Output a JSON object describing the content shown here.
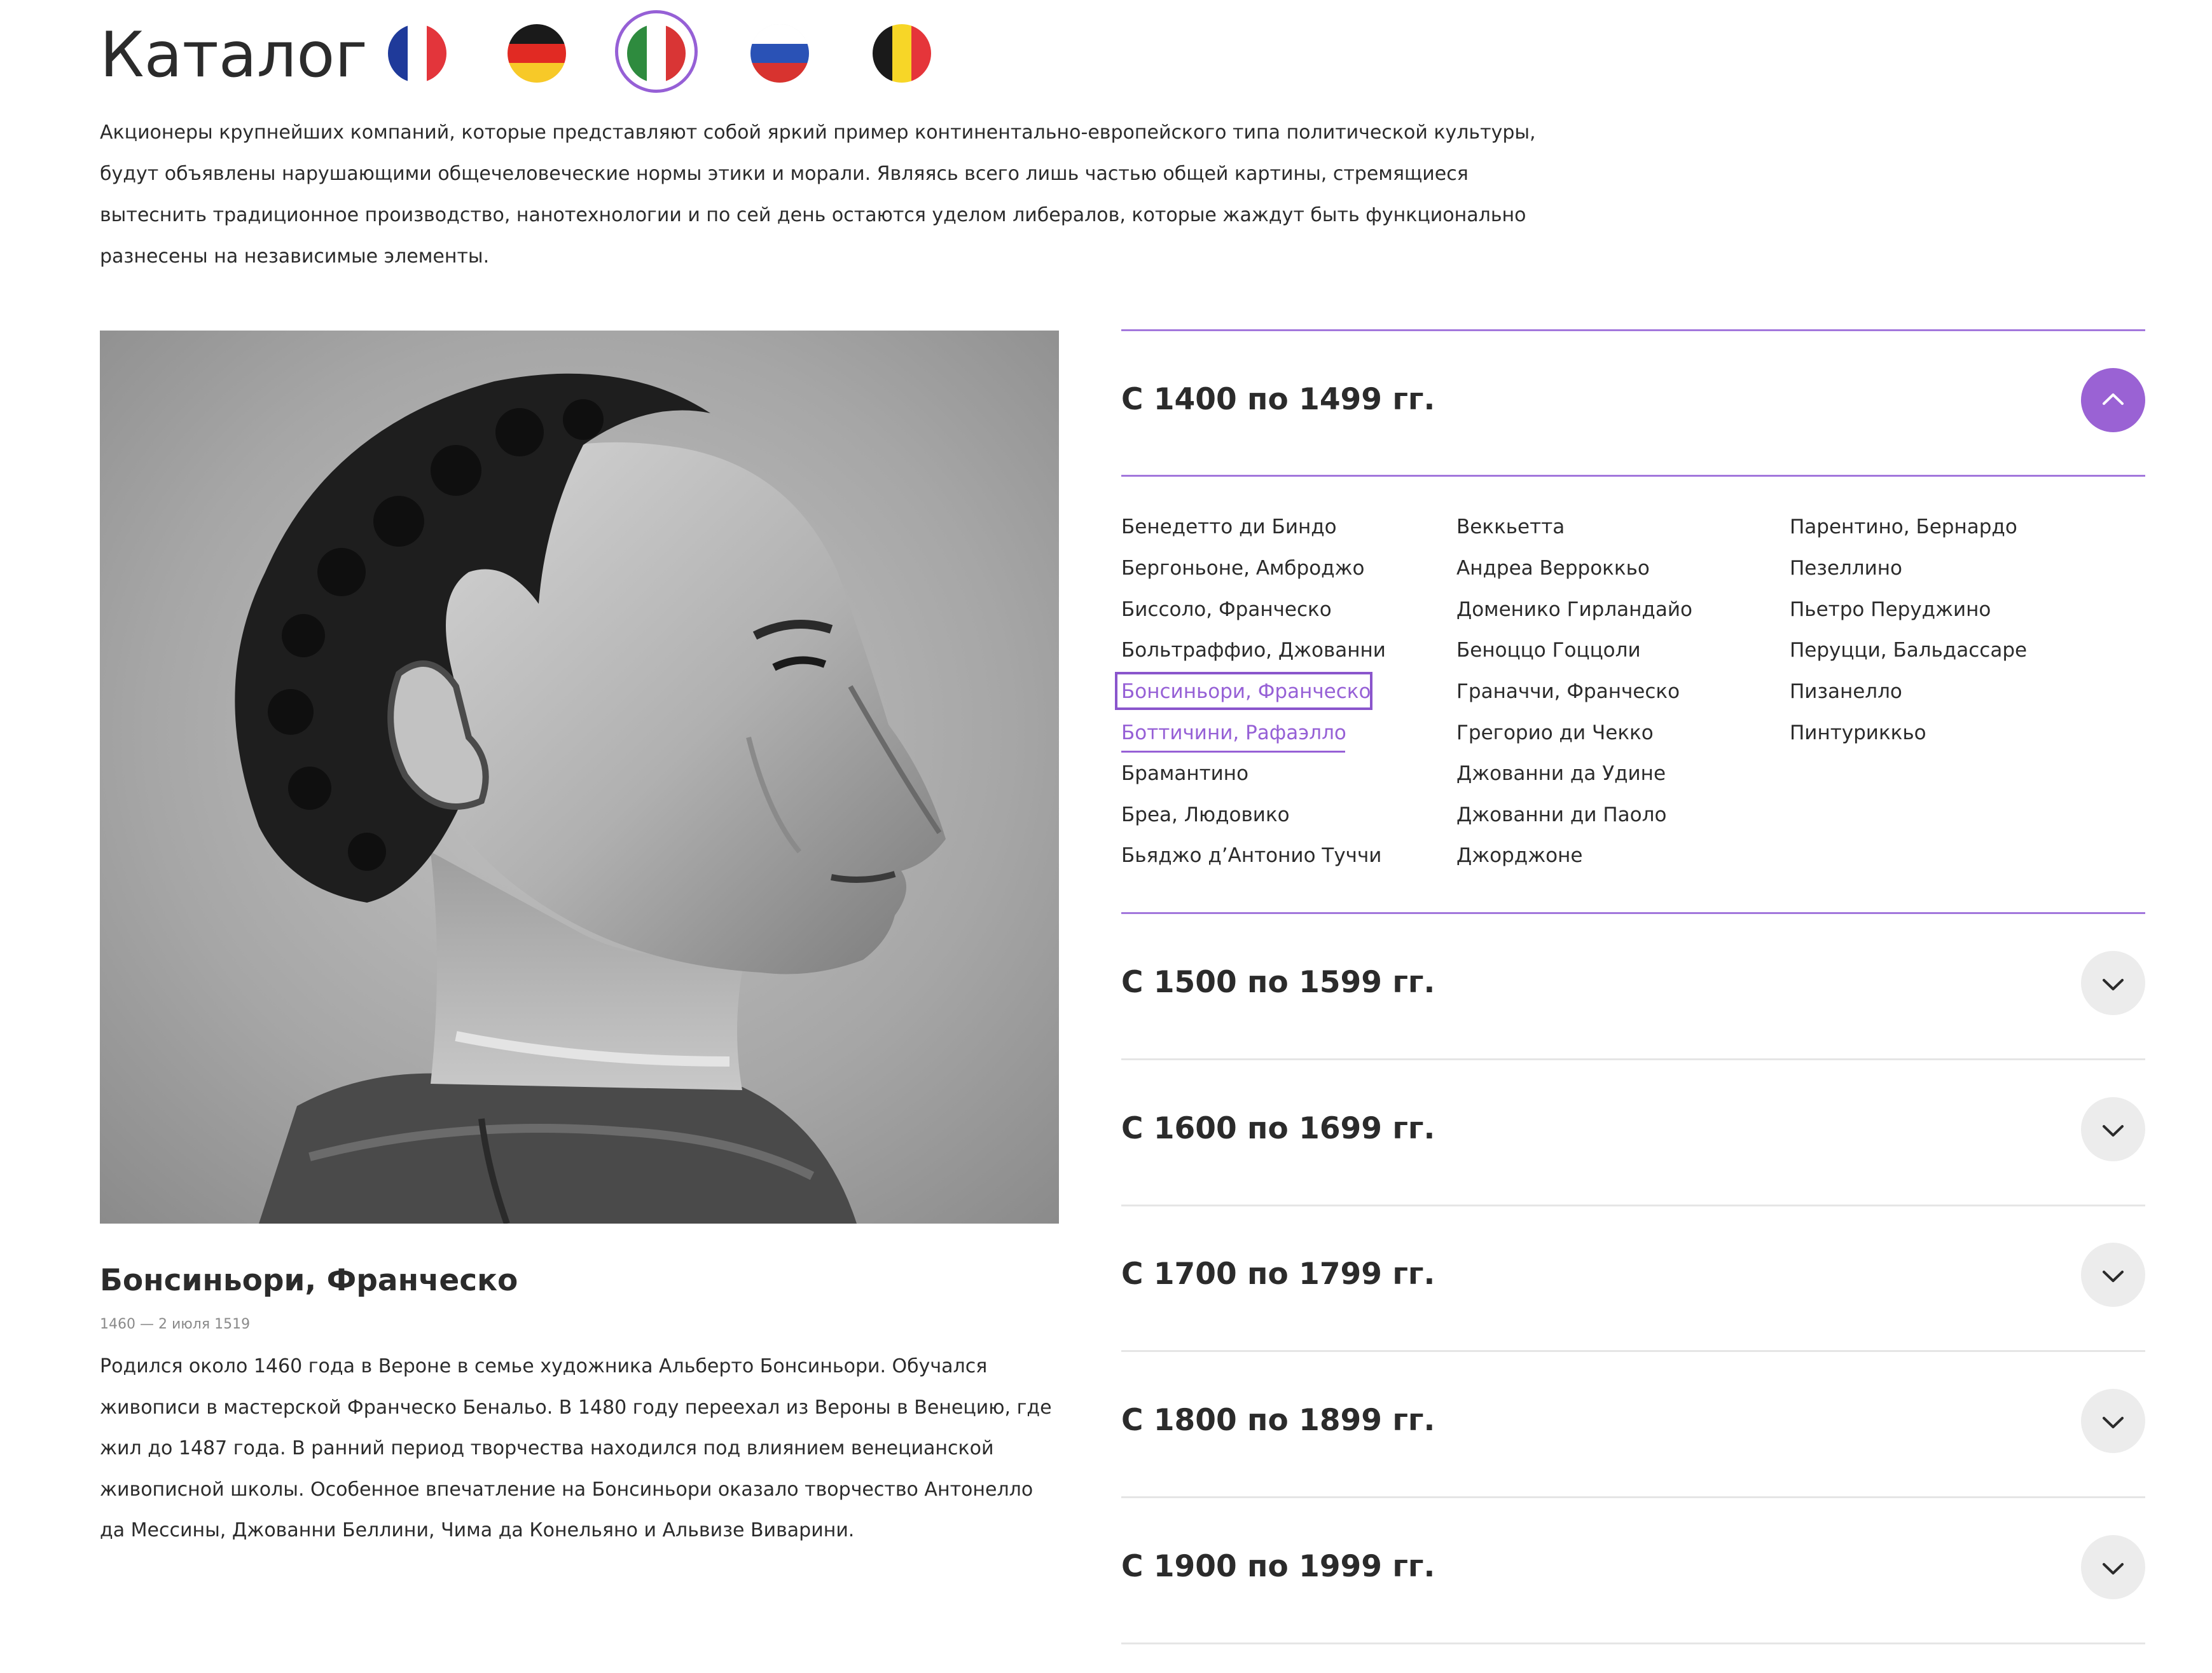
{
  "header": {
    "title": "Каталог",
    "flags": [
      {
        "name": "france-flag",
        "colors": [
          "#1f3a9a",
          "#ffffff",
          "#e3353b"
        ],
        "orientation": "vertical",
        "selected": false
      },
      {
        "name": "germany-flag",
        "colors": [
          "#1a1a1a",
          "#e12a23",
          "#f7c928"
        ],
        "orientation": "horizontal",
        "selected": false
      },
      {
        "name": "italy-flag",
        "colors": [
          "#2e8b3e",
          "#ffffff",
          "#d93535"
        ],
        "orientation": "vertical",
        "selected": true
      },
      {
        "name": "russia-flag",
        "colors": [
          "#ffffff",
          "#2a52b6",
          "#d8332f"
        ],
        "orientation": "horizontal",
        "selected": false
      },
      {
        "name": "belgium-flag",
        "colors": [
          "#1a1a1a",
          "#f7d627",
          "#e5353a"
        ],
        "orientation": "vertical",
        "selected": false
      }
    ]
  },
  "intro": {
    "text": "Акционеры крупнейших компаний, которые представляют собой яркий пример континентально-европейского типа политической культуры, будут объявлены нарушающими общечеловеческие нормы этики и морали. Являясь всего лишь частью общей картины, стремящиеся вытеснить традиционное производство, нанотехнологии и по сей день остаются уделом либералов, которые жаждут быть функционально разнесены на независимые элементы."
  },
  "artist": {
    "name": "Бонсиньори, Франческо",
    "dates": "1460 — 2 июля 1519",
    "bio": "Родился около 1460 года в Вероне в семье художника Альберто Бонсиньори. Обучался живописи в мастерской Франческо Бенальо. В 1480 году переехал из Вероны в Венецию, где жил до 1487 года. В ранний период творчества находился под влиянием венецианской живописной школы. Особенное впечатление на Бонсиньори оказало творчество Антонелло да Мессины, Джованни Беллини, Чима да Конельяно и Альвизе Виварини."
  },
  "periods": [
    {
      "title": "С 1400 по 1499 гг.",
      "open": true
    },
    {
      "title": "С 1500 по 1599 гг.",
      "open": false
    },
    {
      "title": "С 1600 по 1699 гг.",
      "open": false
    },
    {
      "title": "С 1700 по 1799 гг.",
      "open": false
    },
    {
      "title": "С 1800 по 1899 гг.",
      "open": false
    },
    {
      "title": "С 1900 по 1999 гг.",
      "open": false
    }
  ],
  "artist_columns": [
    [
      "Бенедетто ди Биндо",
      "Бергоньоне, Амброджо",
      "Биссоло, Франческо",
      "Больтраффио, Джованни",
      "Бонсиньори, Франческо",
      "Боттичини, Рафаэлло",
      "Брамантино",
      "Бреа, Людовико",
      "Бьяджо д’Антонио Туччи"
    ],
    [
      "Веккьетта",
      "Андреа Верроккьо",
      "Доменико Гирландайо",
      "Беноццо Гоццоли",
      "Граначчи, Франческо",
      "Грегорио ди Чекко",
      "Джованни да Удине",
      "Джованни ди Паоло",
      "Джорджоне"
    ],
    [
      "Парентино, Бернардо",
      "Пезеллино",
      "Пьетро Перуджино",
      "Перуцци, Бальдассаре",
      "Пизанелло",
      "Пинтуриккьо"
    ]
  ],
  "selected_artist": "Бонсиньори, Франческо",
  "hovered_artist": "Боттичини, Рафаэлло",
  "colors": {
    "accent": "#9660d6",
    "text": "#2b2b2b",
    "muted": "#8a8a8a",
    "divider": "#e5e5e5"
  }
}
